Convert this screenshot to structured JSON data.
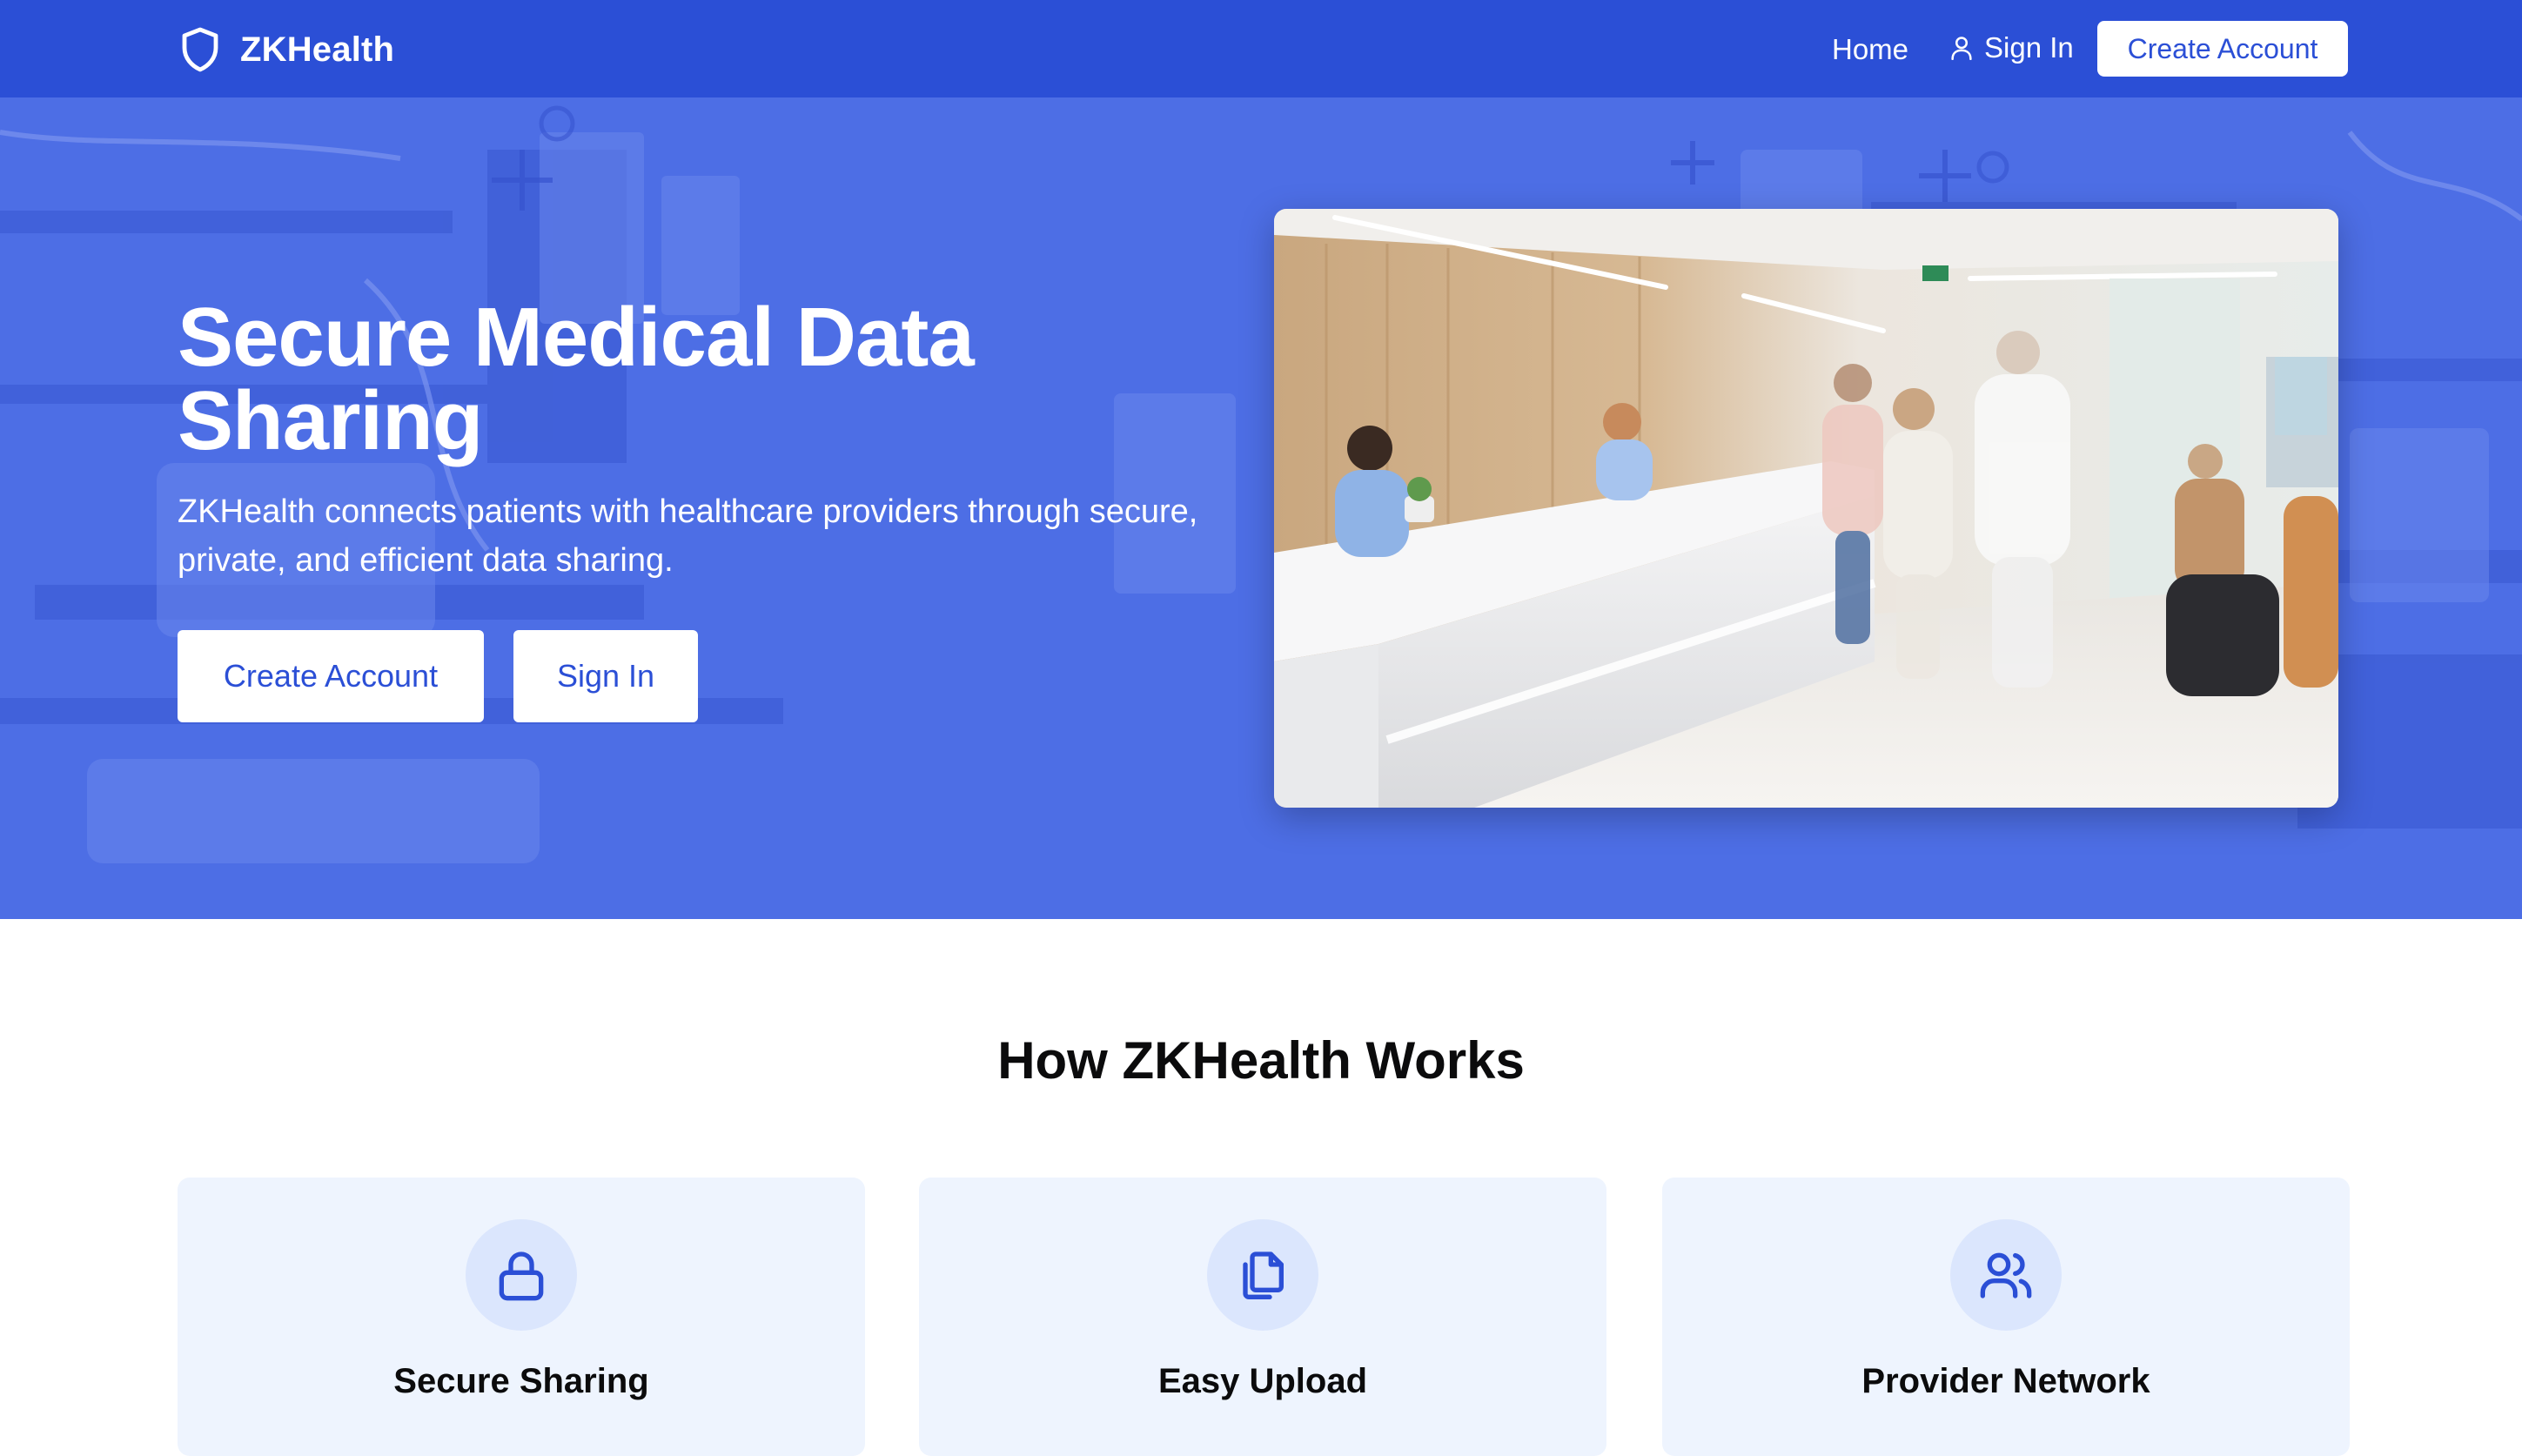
{
  "navbar": {
    "brand": "ZKHealth",
    "home_label": "Home",
    "signin_label": "Sign In",
    "create_account_label": "Create Account"
  },
  "hero": {
    "title": "Secure Medical Data Sharing",
    "subtitle": "ZKHealth connects patients with healthcare providers through secure, private, and efficient data sharing.",
    "create_account_label": "Create Account",
    "signin_label": "Sign In"
  },
  "how_it_works": {
    "title": "How ZKHealth Works",
    "cards": [
      {
        "title": "Secure Sharing",
        "icon": "lock-icon"
      },
      {
        "title": "Easy Upload",
        "icon": "copy-file-icon"
      },
      {
        "title": "Provider Network",
        "icon": "users-icon"
      }
    ]
  },
  "colors": {
    "primary": "#2b4fd6",
    "hero_overlay": "#4e6fe6",
    "card_bg": "#eef4fe",
    "icon_circle": "#dbe6fd",
    "white": "#ffffff"
  }
}
